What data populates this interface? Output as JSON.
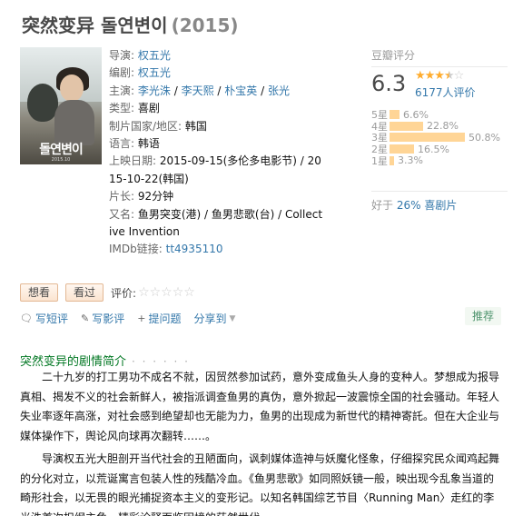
{
  "title": {
    "main": "突然变异 돌연변이",
    "year": "(2015)"
  },
  "poster": {
    "title_text": "돌연변이",
    "date_text": "2015.10"
  },
  "info": {
    "director_label": "导演:",
    "director": "权五光",
    "writer_label": "编剧:",
    "writer": "权五光",
    "cast_label": "主演:",
    "cast": [
      "李光洙",
      "李天熙",
      "朴宝英",
      "张光"
    ],
    "cast_sep": " / ",
    "genre_label": "类型:",
    "genre": "喜剧",
    "country_label": "制片国家/地区:",
    "country": "韩国",
    "language_label": "语言:",
    "language": "韩语",
    "release_label": "上映日期:",
    "release_line1": "2015-09-15(多伦多电影节) / 20",
    "release_line2": "15-10-22(韩国)",
    "runtime_label": "片长:",
    "runtime": "92分钟",
    "aka_label": "又名:",
    "aka_line1": "鱼男突变(港) / 鱼男悲歌(台) / Collect",
    "aka_line2": "ive Invention",
    "imdb_label": "IMDb链接:",
    "imdb": "tt4935110"
  },
  "rating": {
    "header": "豆瓣评分",
    "score": "6.3",
    "stars_value": 3.5,
    "stars_on": "★★★",
    "stars_half": "★",
    "stars_off": "☆",
    "votes": "6177人评价",
    "distribution": [
      {
        "label": "5星",
        "percent": 6.6,
        "text": "6.6%"
      },
      {
        "label": "4星",
        "percent": 22.8,
        "text": "22.8%"
      },
      {
        "label": "3星",
        "percent": 50.8,
        "text": "50.8%"
      },
      {
        "label": "2星",
        "percent": 16.5,
        "text": "16.5%"
      },
      {
        "label": "1星",
        "percent": 3.3,
        "text": "3.3%"
      }
    ],
    "better_prefix": "好于 ",
    "better_link": "26% 喜剧片"
  },
  "actions": {
    "want": "想看",
    "seen": "看过",
    "rate_label": "评价:",
    "rate_stars": "☆☆☆☆☆"
  },
  "tools": {
    "short_review": "写短评",
    "review": "写影评",
    "question": "提问题",
    "share": "分享到",
    "recommend": "推荐"
  },
  "summary": {
    "heading": "突然变异的剧情简介",
    "dots": "· · · · · ·",
    "paragraph1": "二十九岁的打工男功不成名不就，因贸然参加试药，意外变成鱼头人身的变种人。梦想成为报导真相、揭发不义的社会新鲜人，被指派调查鱼男的真伪，意外掀起一波震惊全国的社会骚动。年轻人失业率逐年高涨，对社会感到绝望却也无能为力，鱼男的出现成为新世代的精神寄託。但在大企业与媒体操作下，舆论风向球再次翻转……。",
    "paragraph2": "导演权五光大胆剖开当代社会的丑陋面向，讽刺媒体造神与妖魔化怪象，仔细探究民众闻鸡起舞的分化对立，以荒诞寓言包装人性的残酷冷血。《鱼男悲歌》如同照妖镜一般，映出现今乱象当道的畸形社会，以无畏的眼光捕捉资本主义的变形记。以知名韩国综艺节目〈Running Man〉走红的李光洙首次担纲主角，精彩诠释面临困境的茫然世代。"
  },
  "colors": {
    "link": "#3377aa",
    "star": "#ffac2d",
    "bar": "#ffd596",
    "summary_heading": "#007722"
  }
}
